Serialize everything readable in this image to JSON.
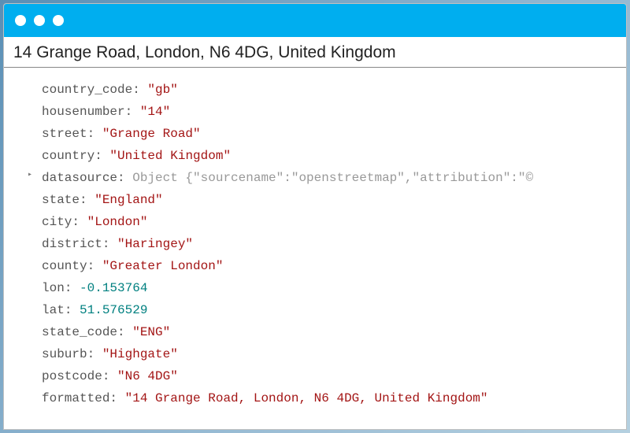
{
  "title": "14 Grange Road, London, N6 4DG, United Kingdom",
  "properties": {
    "country_code": {
      "key": "country_code",
      "value": "\"gb\"",
      "type": "string"
    },
    "housenumber": {
      "key": "housenumber",
      "value": "\"14\"",
      "type": "string"
    },
    "street": {
      "key": "street",
      "value": "\"Grange Road\"",
      "type": "string"
    },
    "country": {
      "key": "country",
      "value": "\"United Kingdom\"",
      "type": "string"
    },
    "datasource": {
      "key": "datasource",
      "value": "Object {\"sourcename\":\"openstreetmap\",\"attribution\":\"©",
      "type": "object",
      "expandable": true
    },
    "state": {
      "key": "state",
      "value": "\"England\"",
      "type": "string"
    },
    "city": {
      "key": "city",
      "value": "\"London\"",
      "type": "string"
    },
    "district": {
      "key": "district",
      "value": "\"Haringey\"",
      "type": "string"
    },
    "county": {
      "key": "county",
      "value": "\"Greater London\"",
      "type": "string"
    },
    "lon": {
      "key": "lon",
      "value": "-0.153764",
      "type": "number"
    },
    "lat": {
      "key": "lat",
      "value": "51.576529",
      "type": "number"
    },
    "state_code": {
      "key": "state_code",
      "value": "\"ENG\"",
      "type": "string"
    },
    "suburb": {
      "key": "suburb",
      "value": "\"Highgate\"",
      "type": "string"
    },
    "postcode": {
      "key": "postcode",
      "value": "\"N6 4DG\"",
      "type": "string"
    },
    "formatted": {
      "key": "formatted",
      "value": "\"14 Grange Road, London, N6 4DG, United Kingdom\"",
      "type": "string"
    }
  },
  "colon": ": ",
  "arrow": "▸"
}
